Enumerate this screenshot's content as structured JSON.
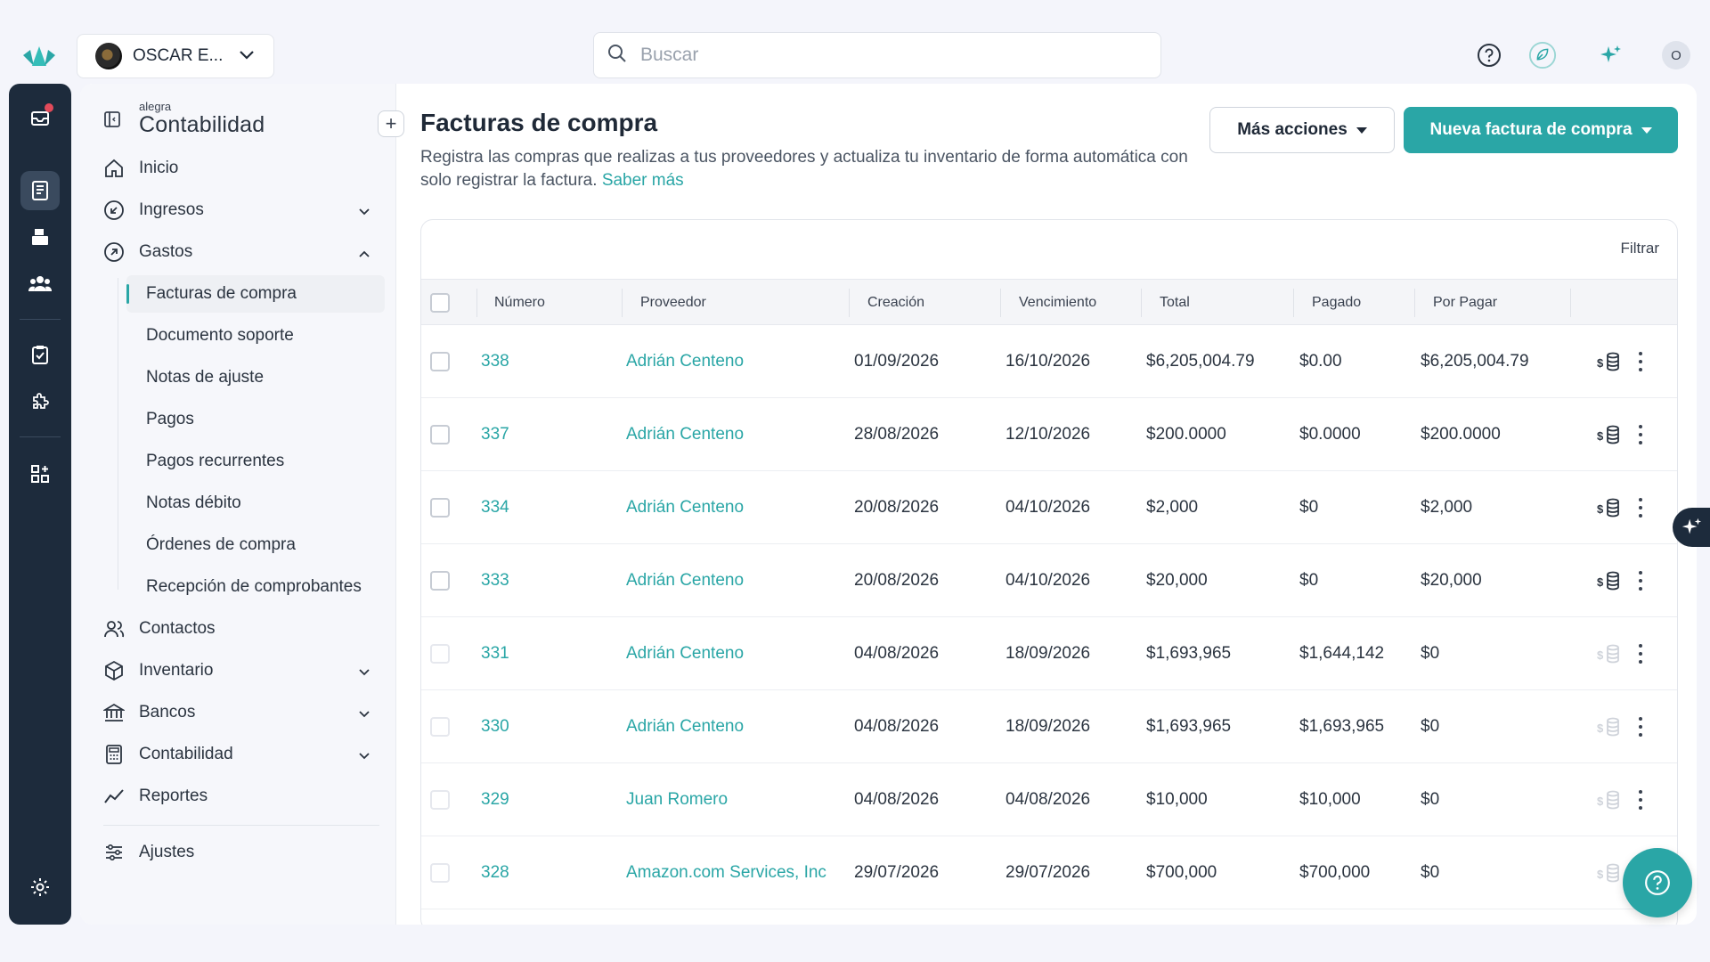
{
  "topbar": {
    "company_name": "OSCAR E...",
    "search_placeholder": "Buscar",
    "user_initial": "O"
  },
  "sidebar": {
    "brand_small": "alegra",
    "brand_name": "Contabilidad",
    "add_label": "+",
    "items": {
      "inicio": "Inicio",
      "ingresos": "Ingresos",
      "gastos": "Gastos",
      "contactos": "Contactos",
      "inventario": "Inventario",
      "bancos": "Bancos",
      "contabilidad": "Contabilidad",
      "reportes": "Reportes",
      "ajustes": "Ajustes"
    },
    "gastos_sub": [
      "Facturas de compra",
      "Documento soporte",
      "Notas de ajuste",
      "Pagos",
      "Pagos recurrentes",
      "Notas débito",
      "Órdenes de compra",
      "Recepción de comprobantes"
    ]
  },
  "main": {
    "title": "Facturas de compra",
    "description": "Registra las compras que realizas a tus proveedores y actualiza tu inventario de forma automática con solo registrar la factura.",
    "learn_more": "Saber más",
    "more_actions": "Más acciones",
    "new_invoice": "Nueva factura de compra",
    "filter": "Filtrar"
  },
  "table": {
    "headers": {
      "numero": "Número",
      "proveedor": "Proveedor",
      "creacion": "Creación",
      "vencimiento": "Vencimiento",
      "total": "Total",
      "pagado": "Pagado",
      "por_pagar": "Por Pagar"
    },
    "rows": [
      {
        "numero": "338",
        "proveedor": "Adrián Centeno",
        "creacion": "01/09/2026",
        "vencimiento": "16/10/2026",
        "total": "$6,205,004.79",
        "pagado": "$0.00",
        "por_pagar": "$6,205,004.79"
      },
      {
        "numero": "337",
        "proveedor": "Adrián Centeno",
        "creacion": "28/08/2026",
        "vencimiento": "12/10/2026",
        "total": "$200.0000",
        "pagado": "$0.0000",
        "por_pagar": "$200.0000"
      },
      {
        "numero": "334",
        "proveedor": "Adrián Centeno",
        "creacion": "20/08/2026",
        "vencimiento": "04/10/2026",
        "total": "$2,000",
        "pagado": "$0",
        "por_pagar": "$2,000"
      },
      {
        "numero": "333",
        "proveedor": "Adrián Centeno",
        "creacion": "20/08/2026",
        "vencimiento": "04/10/2026",
        "total": "$20,000",
        "pagado": "$0",
        "por_pagar": "$20,000"
      },
      {
        "numero": "331",
        "proveedor": "Adrián Centeno",
        "creacion": "04/08/2026",
        "vencimiento": "18/09/2026",
        "total": "$1,693,965",
        "pagado": "$1,644,142",
        "por_pagar": "$0"
      },
      {
        "numero": "330",
        "proveedor": "Adrián Centeno",
        "creacion": "04/08/2026",
        "vencimiento": "18/09/2026",
        "total": "$1,693,965",
        "pagado": "$1,693,965",
        "por_pagar": "$0"
      },
      {
        "numero": "329",
        "proveedor": "Juan Romero",
        "creacion": "04/08/2026",
        "vencimiento": "04/08/2026",
        "total": "$10,000",
        "pagado": "$10,000",
        "por_pagar": "$0"
      },
      {
        "numero": "328",
        "proveedor": "Amazon.com Services, Inc",
        "creacion": "29/07/2026",
        "vencimiento": "29/07/2026",
        "total": "$700,000",
        "pagado": "$700,000",
        "por_pagar": "$0"
      }
    ]
  },
  "colors": {
    "accent": "#2aa6a6",
    "rail": "#1d2b3c",
    "notification": "#e24a5a"
  },
  "icons": [
    "logo-icon",
    "search-icon",
    "help-icon",
    "leaf-icon",
    "sparkle-icon",
    "payment-icon",
    "kebab-icon",
    "settings-icon"
  ]
}
